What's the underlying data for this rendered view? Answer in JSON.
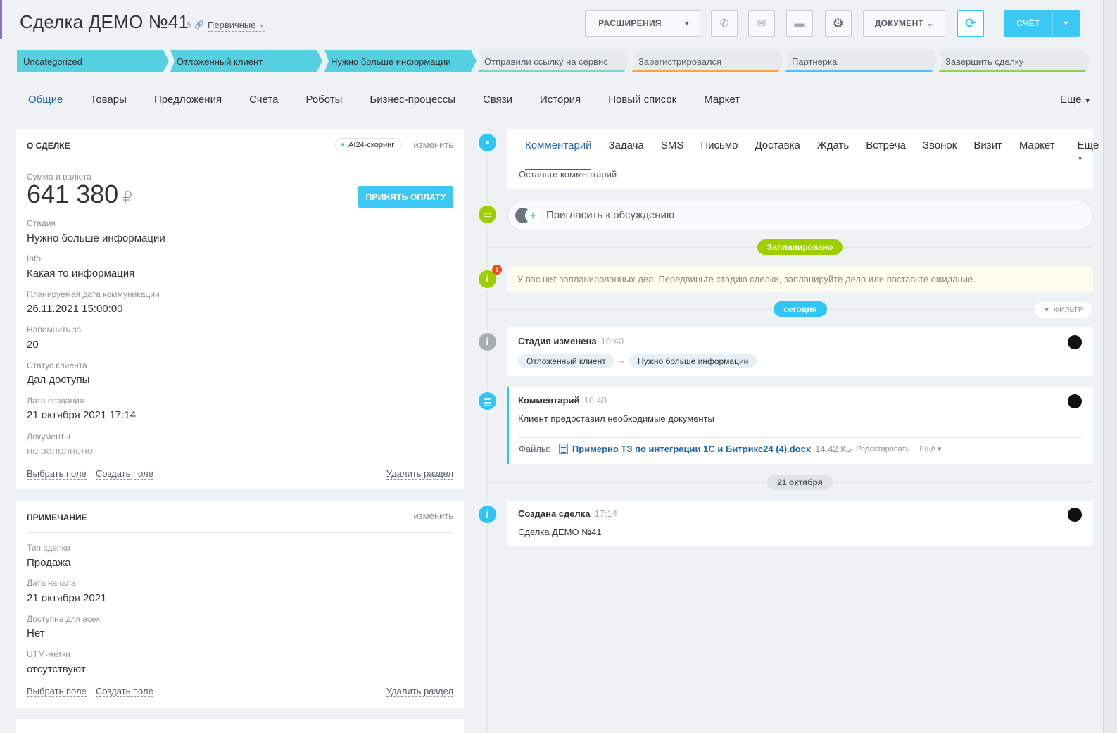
{
  "header": {
    "title": "Сделка ДЕМО  №41",
    "category": "Первичные",
    "buttons": {
      "extensions": "РАСШИРЕНИЯ",
      "document": "ДОКУМЕНТ",
      "bill": "СЧЁТ"
    }
  },
  "stages": [
    {
      "label": "Uncategorized",
      "state": "active",
      "color": "#55d0e0"
    },
    {
      "label": "Отложенный клиент",
      "state": "active",
      "color": "#55d0e0"
    },
    {
      "label": "Нужно больше информации",
      "state": "active",
      "color": "#55d0e0"
    },
    {
      "label": "Отправили ссылку на сервис",
      "state": "pending",
      "color": "#7bd5c8"
    },
    {
      "label": "Зарегистрировался",
      "state": "pending",
      "color": "#f7a541"
    },
    {
      "label": "Партнерка",
      "state": "pending",
      "color": "#4fc0f0"
    },
    {
      "label": "Завершить сделку",
      "state": "pending",
      "color": "#8ed15a"
    }
  ],
  "tabs": [
    "Общие",
    "Товары",
    "Предложения",
    "Счета",
    "Роботы",
    "Бизнес-процессы",
    "Связи",
    "История",
    "Новый список",
    "Маркет"
  ],
  "tabs_more": "Еще",
  "about": {
    "heading": "О СДЕЛКЕ",
    "ai_badge": "AI24-скоринг",
    "edit": "изменить",
    "amount_label": "Сумма и валюта",
    "amount": "641 380",
    "currency": "₽",
    "pay_button": "ПРИНЯТЬ ОПЛАТУ",
    "fields": [
      {
        "label": "Стадия",
        "value": "Нужно больше информации"
      },
      {
        "label": "Info",
        "value": "Какая то информация"
      },
      {
        "label": "Планируемая дата коммуникации",
        "value": "26.11.2021 15:00:00"
      },
      {
        "label": "Напомнить за",
        "value": "20"
      },
      {
        "label": "Статус клиента",
        "value": "Дал доступы"
      },
      {
        "label": "Дата создания",
        "value": "21 октября 2021 17:14"
      },
      {
        "label": "Документы",
        "value": "не заполнено"
      }
    ],
    "select_field": "Выбрать поле",
    "create_field": "Создать поле",
    "delete_section": "Удалить раздел"
  },
  "note": {
    "heading": "ПРИМЕЧАНИЕ",
    "edit": "изменить",
    "fields": [
      {
        "label": "Тип сделки",
        "value": "Продажа"
      },
      {
        "label": "Дата начала",
        "value": "21 октября 2021"
      },
      {
        "label": "Доступна для всех",
        "value": "Нет"
      },
      {
        "label": "UTM-метки",
        "value": "отсутствуют"
      }
    ],
    "select_field": "Выбрать поле",
    "create_field": "Создать поле",
    "delete_section": "Удалить раздел"
  },
  "activity": {
    "tabs": [
      "Комментарий",
      "Задача",
      "SMS",
      "Письмо",
      "Доставка",
      "Ждать",
      "Встреча",
      "Звонок",
      "Визит",
      "Маркет"
    ],
    "more": "Еще",
    "placeholder": "Оставьте комментарий"
  },
  "timeline": {
    "invite": "Пригласить к обсуждению",
    "planned_pill": "Запланировано",
    "notice": "У вас нет запланированных дел. Передвиньте стадию сделки, запланируйте дело или поставьте ожидание.",
    "notice_badge": "1",
    "today_pill": "сегодня",
    "filter": "ФИЛЬТР",
    "events": [
      {
        "title": "Стадия изменена",
        "time": "10:40",
        "from": "Отложенный клиент",
        "to": "Нужно больше информации"
      },
      {
        "title": "Комментарий",
        "time": "10:40",
        "text": "Клиент предоставил необходимые документы",
        "files_label": "Файлы:",
        "file_name": "Примерно ТЗ по интеграции 1С и Битрикс24 (4).docx",
        "file_size": "14.42 КБ",
        "file_edit": "Редактировать",
        "file_more": "Ещё"
      },
      {
        "title": "Создана сделка",
        "time": "17:14",
        "text": "Сделка ДЕМО №41"
      }
    ],
    "date_pill": "21 октября"
  }
}
